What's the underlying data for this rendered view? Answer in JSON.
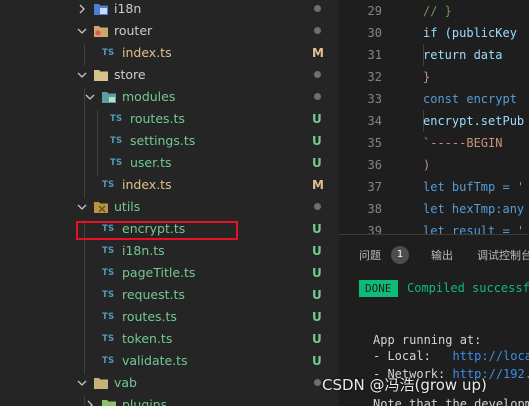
{
  "explorer": {
    "items": [
      {
        "label": "i18n",
        "kind": "folder",
        "icon": "i18n-folder-icon",
        "expanded": false,
        "status": "dot"
      },
      {
        "label": "router",
        "kind": "folder",
        "icon": "router-folder-icon",
        "expanded": true,
        "status": "dot"
      },
      {
        "label": "index.ts",
        "kind": "file",
        "icon": "typescript-icon",
        "status": "M"
      },
      {
        "label": "store",
        "kind": "folder",
        "icon": "store-folder-icon",
        "expanded": true,
        "status": "dot"
      },
      {
        "label": "modules",
        "kind": "folder",
        "icon": "modules-folder-icon",
        "expanded": true,
        "status": "dot"
      },
      {
        "label": "routes.ts",
        "kind": "file",
        "icon": "typescript-icon",
        "status": "U"
      },
      {
        "label": "settings.ts",
        "kind": "file",
        "icon": "typescript-icon",
        "status": "U"
      },
      {
        "label": "user.ts",
        "kind": "file",
        "icon": "typescript-icon",
        "status": "U"
      },
      {
        "label": "index.ts",
        "kind": "file",
        "icon": "typescript-icon",
        "status": "M"
      },
      {
        "label": "utils",
        "kind": "folder",
        "icon": "utils-folder-icon",
        "expanded": true,
        "status": "dot"
      },
      {
        "label": "encrypt.ts",
        "kind": "file",
        "icon": "typescript-icon",
        "status": "U",
        "highlighted": true
      },
      {
        "label": "i18n.ts",
        "kind": "file",
        "icon": "typescript-icon",
        "status": "U"
      },
      {
        "label": "pageTitle.ts",
        "kind": "file",
        "icon": "typescript-icon",
        "status": "U"
      },
      {
        "label": "request.ts",
        "kind": "file",
        "icon": "typescript-icon",
        "status": "U"
      },
      {
        "label": "routes.ts",
        "kind": "file",
        "icon": "typescript-icon",
        "status": "U"
      },
      {
        "label": "token.ts",
        "kind": "file",
        "icon": "typescript-icon",
        "status": "U"
      },
      {
        "label": "validate.ts",
        "kind": "file",
        "icon": "typescript-icon",
        "status": "U"
      },
      {
        "label": "vab",
        "kind": "folder",
        "icon": "folder-icon",
        "expanded": true,
        "status": "dot"
      },
      {
        "label": "plugins",
        "kind": "folder",
        "icon": "plugins-folder-icon",
        "expanded": false,
        "status": "dot"
      }
    ],
    "ts_icon_text": "TS"
  },
  "editor": {
    "lines": [
      {
        "num": "29",
        "code": "// }"
      },
      {
        "num": "30",
        "code": "if (publicKey"
      },
      {
        "num": "31",
        "code": "  return data"
      },
      {
        "num": "32",
        "code": "}"
      },
      {
        "num": "33",
        "code": "const encrypt"
      },
      {
        "num": "34",
        "code": "encrypt.setPub"
      },
      {
        "num": "35",
        "code": "  `-----BEGIN"
      },
      {
        "num": "36",
        "code": ")"
      },
      {
        "num": "37",
        "code": "let bufTmp = '"
      },
      {
        "num": "38",
        "code": "let hexTmp:any"
      },
      {
        "num": "39",
        "code": "let result = '"
      },
      {
        "num": "40",
        "code": ""
      }
    ]
  },
  "panel": {
    "tabs": [
      {
        "label": "问题"
      },
      {
        "label": "输出"
      },
      {
        "label": "调试控制台"
      }
    ],
    "problems_count": "1",
    "terminal": {
      "done_label": "DONE",
      "compiled_text": "Compiled successfu",
      "app_running": "App running at:",
      "local_label": "- Local:   ",
      "local_url": "http://loca",
      "network_label": "- Network: ",
      "network_url": "http://192.",
      "note": "Note that the developm"
    }
  },
  "watermark": "CSDN @冯浩(grow up)",
  "colors": {
    "untracked": "#73c991",
    "modified": "#e2c08d",
    "typescript": "#519aba",
    "highlight": "#e81123",
    "done": "#0dbc79"
  }
}
